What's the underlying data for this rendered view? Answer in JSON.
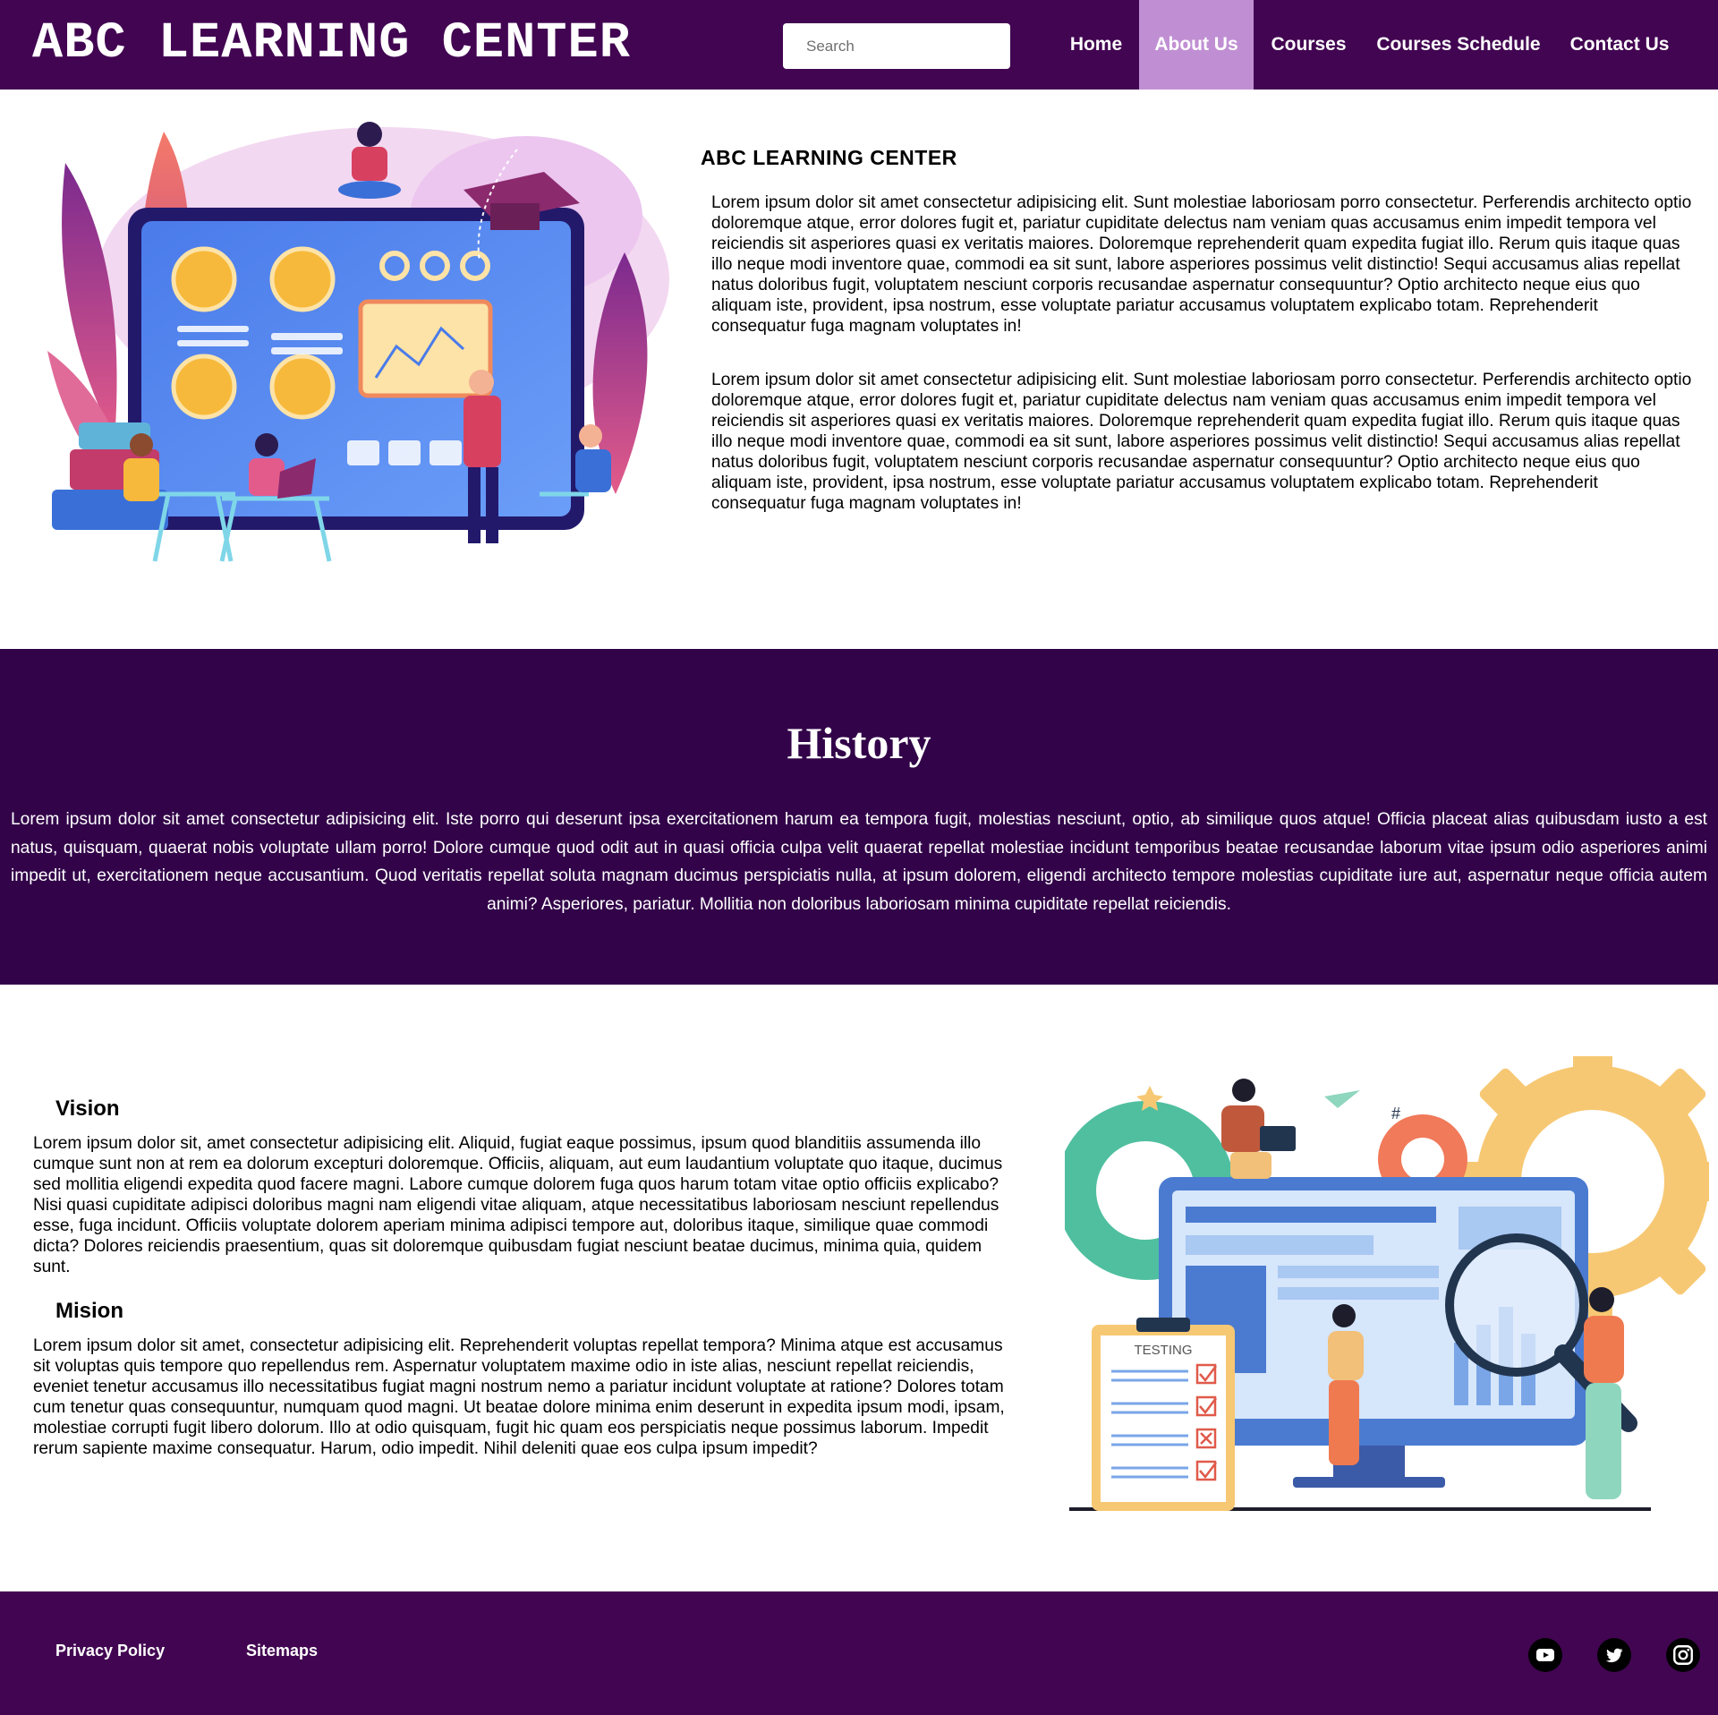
{
  "header": {
    "brand": "ABC LEARNING CENTER",
    "search_placeholder": "Search",
    "nav": [
      {
        "label": "Home",
        "active": false
      },
      {
        "label": "About Us",
        "active": true
      },
      {
        "label": "Courses",
        "active": false
      },
      {
        "label": "Courses Schedule",
        "active": false
      },
      {
        "label": "Contact Us",
        "active": false
      }
    ]
  },
  "about": {
    "title": "ABC LEARNING CENTER",
    "paragraphs": [
      "Lorem ipsum dolor sit amet consectetur adipisicing elit. Sunt molestiae laboriosam porro consectetur. Perferendis architecto optio doloremque atque, error dolores fugit et, pariatur cupiditate delectus nam veniam quas accusamus enim impedit tempora vel reiciendis sit asperiores quasi ex veritatis maiores. Doloremque reprehenderit quam expedita fugiat illo. Rerum quis itaque quas illo neque modi inventore quae, commodi ea sit sunt, labore asperiores possimus velit distinctio! Sequi accusamus alias repellat natus doloribus fugit, voluptatem nesciunt corporis recusandae aspernatur consequuntur? Optio architecto neque eius quo aliquam iste, provident, ipsa nostrum, esse voluptate pariatur accusamus voluptatem explicabo totam. Reprehenderit consequatur fuga magnam voluptates in!",
      "Lorem ipsum dolor sit amet consectetur adipisicing elit. Sunt molestiae laboriosam porro consectetur. Perferendis architecto optio doloremque atque, error dolores fugit et, pariatur cupiditate delectus nam veniam quas accusamus enim impedit tempora vel reiciendis sit asperiores quasi ex veritatis maiores. Doloremque reprehenderit quam expedita fugiat illo. Rerum quis itaque quas illo neque modi inventore quae, commodi ea sit sunt, labore asperiores possimus velit distinctio! Sequi accusamus alias repellat natus doloribus fugit, voluptatem nesciunt corporis recusandae aspernatur consequuntur? Optio architecto neque eius quo aliquam iste, provident, ipsa nostrum, esse voluptate pariatur accusamus voluptatem explicabo totam. Reprehenderit consequatur fuga magnam voluptates in!"
    ]
  },
  "history": {
    "title": "History",
    "text": "Lorem ipsum dolor sit amet consectetur adipisicing elit. Iste porro qui deserunt ipsa exercitationem harum ea tempora fugit, molestias nesciunt, optio, ab similique quos atque! Officia placeat alias quibusdam iusto a est natus, quisquam, quaerat nobis voluptate ullam porro! Dolore cumque quod odit aut in quasi officia culpa velit quaerat repellat molestiae incidunt temporibus beatae recusandae laborum vitae ipsum odio asperiores animi impedit ut, exercitationem neque accusantium. Quod veritatis repellat soluta magnam ducimus perspiciatis nulla, at ipsum dolorem, eligendi architecto tempore molestias cupiditate iure aut, aspernatur neque officia autem animi? Asperiores, pariatur. Mollitia non doloribus laboriosam minima cupiditate repellat reiciendis."
  },
  "vision": {
    "title": "Vision",
    "text": "Lorem ipsum dolor sit, amet consectetur adipisicing elit. Aliquid, fugiat eaque possimus, ipsum quod blanditiis assumenda illo cumque sunt non at rem ea dolorum excepturi doloremque. Officiis, aliquam, aut eum laudantium voluptate quo itaque, ducimus sed mollitia eligendi expedita quod facere magni. Labore cumque dolorem fuga quos harum totam vitae optio officiis explicabo? Nisi quasi cupiditate adipisci doloribus magni nam eligendi vitae aliquam, atque necessitatibus laboriosam nesciunt repellendus esse, fuga incidunt. Officiis voluptate dolorem aperiam minima adipisci tempore aut, doloribus itaque, similique quae commodi dicta? Dolores reiciendis praesentium, quas sit doloremque quibusdam fugiat nesciunt beatae ducimus, minima quia, quidem sunt."
  },
  "mission": {
    "title": "Mision",
    "text": "Lorem ipsum dolor sit amet, consectetur adipisicing elit. Reprehenderit voluptas repellat tempora? Minima atque est accusamus sit voluptas quis tempore quo repellendus rem. Aspernatur voluptatem maxime odio in iste alias, nesciunt repellat reiciendis, eveniet tenetur accusamus illo necessitatibus fugiat magni nostrum nemo a pariatur incidunt voluptate at ratione? Dolores totam cum tenetur quas consequuntur, numquam quod magni. Ut beatae dolore minima enim deserunt in expedita ipsum modi, ipsam, molestiae corrupti fugit libero dolorum. Illo at odio quisquam, fugit hic quam eos perspiciatis neque possimus laborum. Impedit rerum sapiente maxime consequatur. Harum, odio impedit. Nihil deleniti quae eos culpa ipsum impedit?"
  },
  "illustration_text": {
    "testing_label": "TESTING"
  },
  "footer": {
    "links": [
      "Privacy Policy",
      "Sitemaps"
    ],
    "social": [
      {
        "icon": "youtube-icon"
      },
      {
        "icon": "twitter-icon"
      },
      {
        "icon": "instagram-icon"
      }
    ]
  },
  "colors": {
    "header_bg": "#420552",
    "active_nav_bg": "#c08fd3",
    "history_bg": "#320349",
    "footer_bg": "#420552"
  }
}
